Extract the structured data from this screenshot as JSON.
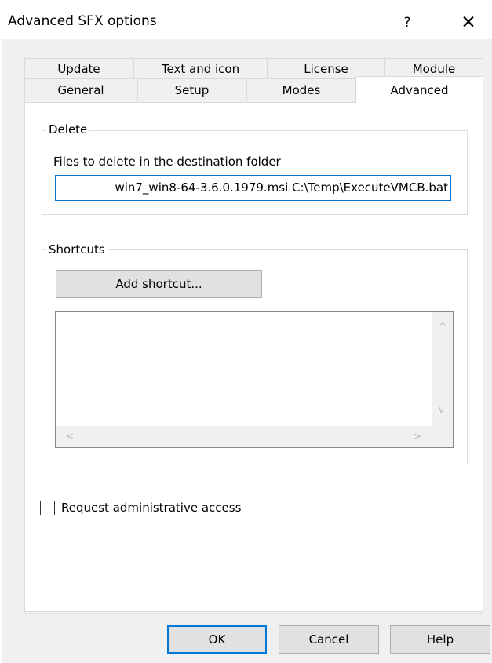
{
  "window": {
    "title": "Advanced SFX options",
    "help_glyph": "?",
    "close_glyph": "✕"
  },
  "tabs": {
    "row1": [
      "Update",
      "Text and icon",
      "License",
      "Module"
    ],
    "row2": [
      "General",
      "Setup",
      "Modes",
      "Advanced"
    ],
    "active": "Advanced"
  },
  "delete_group": {
    "legend": "Delete",
    "field_label": "Files to delete in the destination folder",
    "field_value": "win7_win8-64-3.6.0.1979.msi C:\\Temp\\ExecuteVMCB.bat"
  },
  "shortcuts_group": {
    "legend": "Shortcuts",
    "add_button": "Add shortcut...",
    "scroll_up": "^",
    "scroll_down": "v",
    "scroll_left": "<",
    "scroll_right": ">"
  },
  "admin_checkbox": {
    "label": "Request administrative access",
    "checked": false
  },
  "buttons": {
    "ok": "OK",
    "cancel": "Cancel",
    "help": "Help"
  },
  "colors": {
    "accent": "#0078d7",
    "dialog_bg": "#f0f0f0",
    "button_bg": "#e1e1e1"
  }
}
